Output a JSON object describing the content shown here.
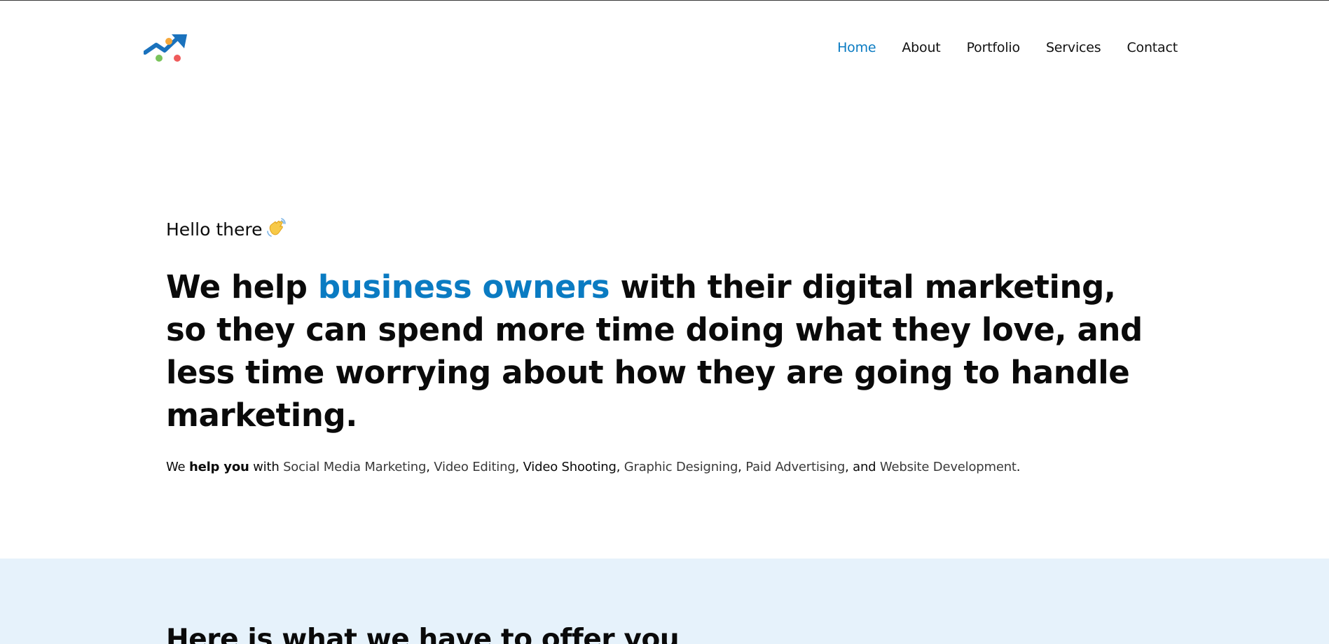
{
  "colors": {
    "accent": "#0a7bc2",
    "offer_bg": "#e6f2fb",
    "logo_blue": "#1a72bd",
    "logo_dot_orange": "#f6a83b",
    "logo_dot_green": "#79c35a",
    "logo_dot_red": "#ef5b5b"
  },
  "header": {
    "logo_icon": "growth-arrow-logo-icon",
    "nav": [
      {
        "label": "Home",
        "active": true
      },
      {
        "label": "About",
        "active": false
      },
      {
        "label": "Portfolio",
        "active": false
      },
      {
        "label": "Services",
        "active": false
      },
      {
        "label": "Contact",
        "active": false
      }
    ]
  },
  "hero": {
    "greeting": "Hello there",
    "greeting_icon": "waving-hand-icon",
    "headline_before": "We help ",
    "headline_highlight": "business owners",
    "headline_after": " with their digital marketing, so they can spend more time doing what they love, and less time worrying about how they are going to handle marketing.",
    "services_intro": "We ",
    "services_bold": "help you",
    "services_with": " with ",
    "services": [
      "Social Media Marketing",
      "Video Editing",
      "Video Shooting",
      "Graphic Designing",
      "Paid Advertising",
      "Website Development"
    ],
    "sep_comma": ", ",
    "sep_and": ", and ",
    "end_period": "."
  },
  "offer": {
    "title": "Here is what we have to offer you"
  }
}
